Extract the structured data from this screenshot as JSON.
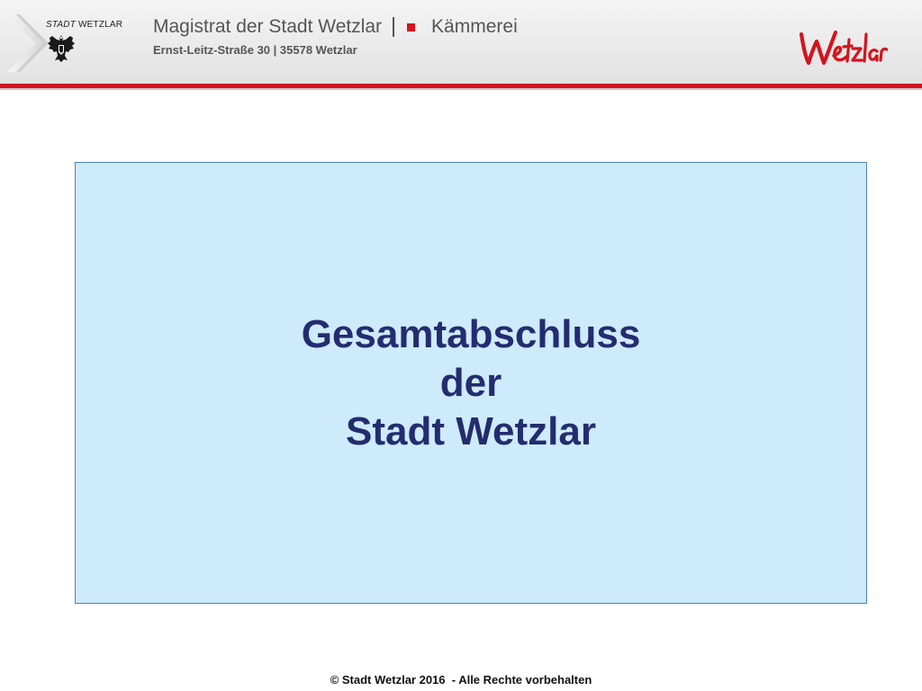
{
  "header": {
    "org_line": "Magistrat der Stadt Wetzlar",
    "department": "Kämmerei",
    "address": "Ernst-Leitz-Straße 30 | 35578 Wetzlar",
    "stadt_word": "STADT",
    "wetzlar_word": "WETZLAR",
    "logo_text": "Wetzlar",
    "coat_of_arms_icon": "eagle-coat-of-arms-icon"
  },
  "main": {
    "title_lines": [
      "Gesamtabschluss",
      "der",
      "Stadt Wetzlar"
    ]
  },
  "footer": {
    "copyright": "© Stadt Wetzlar 2016  - Alle Rechte vorbehalten"
  },
  "colors": {
    "accent_red": "#d2151e",
    "title_navy": "#242c6f",
    "box_fill": "#cdebfb",
    "box_border": "#4f81bd"
  }
}
